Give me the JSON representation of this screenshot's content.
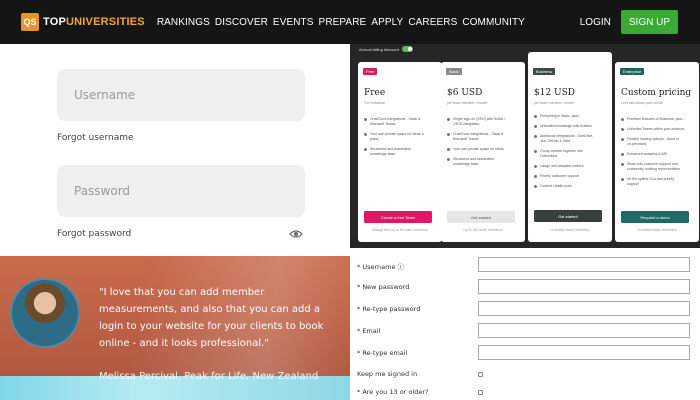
{
  "nav": {
    "logo_badge": "QS",
    "logo_top": "TOP",
    "logo_univ": "UNIVERSITIES",
    "links": [
      "RANKINGS",
      "DISCOVER",
      "EVENTS",
      "PREPARE",
      "APPLY",
      "CAREERS",
      "COMMUNITY"
    ],
    "login": "LOGIN",
    "signup": "SIGN UP"
  },
  "login_form": {
    "username_placeholder": "Username",
    "forgot_username": "Forgot username",
    "password_placeholder": "Password",
    "forgot_password": "Forgot password"
  },
  "testimonial": {
    "quote": "\"I love that you can add member measurements, and also that you can add a login to your website for your clients to book online - and it looks professional.\"",
    "author": "Melissa Percival, Peak for Life, New Zealand"
  },
  "pricing": {
    "billing_label": "Annual billing discount",
    "plans": [
      {
        "badge": "Free",
        "badge_color": "#d81b60",
        "name": "Free",
        "sub": "For individual",
        "features": [
          "Chat/Docs integrations - Slack & Microsoft Teams",
          "Your own private space for ideas & plans",
          "Structured and searchable knowledge base"
        ],
        "button": "Create a free Team",
        "button_bg": "#e0186a",
        "button_color": "#ffffff",
        "footer": "Always free up to 50 team members"
      },
      {
        "badge": "Basic",
        "badge_color": "#8a8a8a",
        "name": "$6 USD",
        "sub": "per team member / month",
        "features": [
          "Single sign-on (SSO) with SAML / OKTA integration",
          "Chat/Docs integrations - Slack & Microsoft Teams",
          "Your own private space for ideas",
          "Structured and searchable knowledge base"
        ],
        "button": "Get started",
        "button_bg": "#e6e6e6",
        "button_color": "#555555",
        "footer": "Up to 250 team members"
      },
      {
        "badge": "Business",
        "badge_color": "#3f4a44",
        "name": "$12 USD",
        "sub": "per team member / month",
        "features": [
          "Everything in Basic, plus...",
          "Unlimited knowledge with Articles",
          "Additional integrations - OneDrive, Jira, GitHub & Okta",
          "Group content together into Collections",
          "Usage and adoption metrics",
          "Priority customer support",
          "Content Health tools"
        ],
        "button": "Get started",
        "button_bg": "#39403c",
        "button_color": "#ffffff",
        "footer": "Unlimited team members"
      },
      {
        "badge": "Enterprise",
        "badge_color": "#21625c",
        "name": "Custom pricing",
        "sub": "Let's talk about your needs",
        "features": [
          "Premium features of Business, plus...",
          "Unlimited Teams within your instance",
          "Flexible hosting options - cloud or on-premises",
          "Enhanced analytics & API",
          "Read-only customer support and community building representative",
          "99.5% uptime SLA and priority support"
        ],
        "button": "Request a demo",
        "button_bg": "#1f6a64",
        "button_color": "#ffffff",
        "footer": "Unlimited team members"
      }
    ]
  },
  "registration": {
    "fields": [
      {
        "label": "* Username",
        "type": "text",
        "help_icon": "ⓘ"
      },
      {
        "label": "* New password",
        "type": "text"
      },
      {
        "label": "* Re-type password",
        "type": "text"
      },
      {
        "label": "* Email",
        "type": "text"
      },
      {
        "label": "* Re-type email",
        "type": "text"
      },
      {
        "label": "Keep me signed in",
        "type": "checkbox"
      },
      {
        "label": "* Are you 13 or older?",
        "type": "checkbox"
      }
    ]
  }
}
